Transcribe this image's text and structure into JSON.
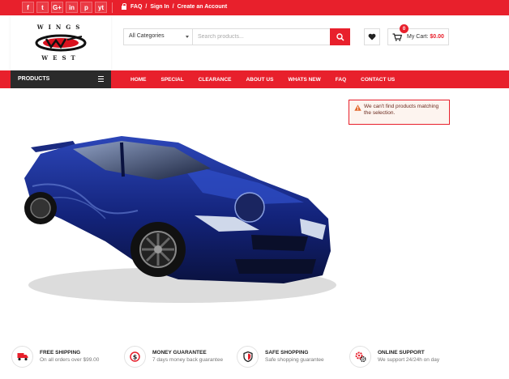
{
  "topbar": {
    "social": [
      "f",
      "t",
      "G+",
      "in",
      "p",
      "yt"
    ],
    "social_names": [
      "facebook-icon",
      "twitter-icon",
      "google-plus-icon",
      "linkedin-icon",
      "pinterest-icon",
      "youtube-icon"
    ],
    "links": {
      "faq": "FAQ",
      "signin": "Sign In",
      "create": "Create an Account",
      "sep": "/"
    }
  },
  "logo": {
    "top": "WINGS",
    "bottom": "WEST"
  },
  "search": {
    "category": "All Categories",
    "placeholder": "Search products..."
  },
  "cart": {
    "count": "0",
    "label": "My Cart:",
    "amount": "$0.00"
  },
  "nav": {
    "products": "PRODUCTS",
    "items": [
      "HOME",
      "SPECIAL",
      "CLEARANCE",
      "ABOUT US",
      "WHATS NEW",
      "FAQ",
      "CONTACT US"
    ]
  },
  "alert": {
    "message": "We can't find products matching the selection."
  },
  "features": [
    {
      "title": "FREE SHIPPING",
      "sub": "On all orders over $99.00"
    },
    {
      "title": "MONEY GUARANTEE",
      "sub": "7 days money back guarantee"
    },
    {
      "title": "SAFE SHOPPING",
      "sub": "Safe shopping guarantee"
    },
    {
      "title": "ONLINE SUPPORT",
      "sub": "We support 24/24h on day"
    }
  ],
  "colors": {
    "accent": "#e8202c",
    "dark": "#2a2a2a"
  }
}
